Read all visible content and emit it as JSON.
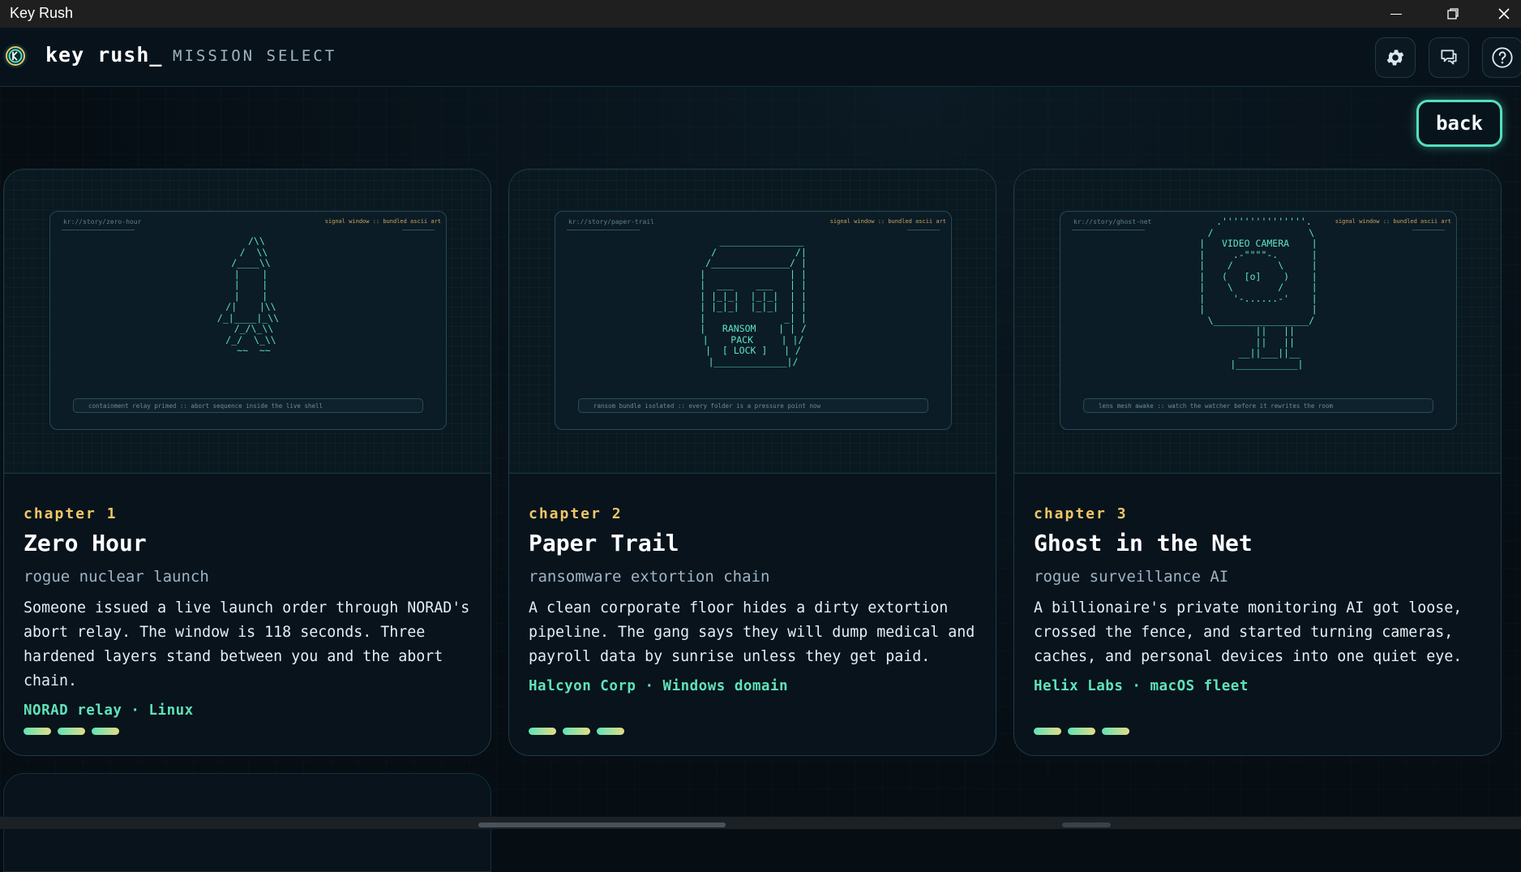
{
  "window": {
    "title": "Key Rush",
    "minimize_glyph": "—",
    "close_glyph": "✕"
  },
  "header": {
    "logo_glyph": "K",
    "brand": "key rush_",
    "subtitle": "MISSION SELECT",
    "icons": [
      "gear-icon",
      "chat-icon",
      "help-icon"
    ]
  },
  "back_label": "back",
  "cards": [
    {
      "url": "kr://story/zero-hour",
      "signal": "signal window :: bundled ascii art",
      "ascii": "   /\\\\\n  /  \\\\\n /____\\\\\n |    |\n |    |\n |    |\n /|    |\\\\\n/_|____|_\\\\\n  /_/\\_\\\\\n /_/  \\_\\\\\n  ~~  ~~",
      "status": "containment relay primed :: abort sequence inside the live shell",
      "chapter": "chapter 1",
      "title": "Zero Hour",
      "subtitle": "rogue nuclear launch",
      "description": "Someone issued a live launch order through NORAD's abort relay. The window is 118 seconds. Three hardened layers stand between you and the abort chain.",
      "meta": "NORAD relay · Linux"
    },
    {
      "url": "kr://story/paper-trail",
      "signal": "signal window :: bundled ascii art",
      "ascii": "   _______________\n  /              /|\n /______________/ |\n|               | |\n|  ___    ___   | |\n| |_|_|  |_|_|  | |\n| |_|_|  |_|_|  | |\n|              _| |\n|   RANSOM    | | /\n|    PACK     | |/\n|  [ LOCK ]   | /\n|_____________|/",
      "status": "ransom bundle isolated :: every folder is a pressure point now",
      "chapter": "chapter 2",
      "title": "Paper Trail",
      "subtitle": "ransomware extortion chain",
      "description": "A clean corporate floor hides a dirty extortion pipeline. The gang says they will dump medical and payroll data by sunrise unless they get paid.",
      "meta": "Halcyon Corp · Windows domain"
    },
    {
      "url": "kr://story/ghost-net",
      "signal": "signal window :: bundled ascii art",
      "ascii": "  .'''''''''''''''.\n /                 \\\n|   VIDEO CAMERA    |\n|     .-\"\"\"\"-.      |\n|    /        \\     |\n|   (   [o]    )    |\n|    \\        /     |\n|     '-......-'    |\n|                   |\n \\_________________/\n      ||   ||\n      ||   ||\n    __||___||__\n   |___________|",
      "status": "lens mesh awake :: watch the watcher before it rewrites the room",
      "chapter": "chapter 3",
      "title": "Ghost in the Net",
      "subtitle": "rogue surveillance AI",
      "description": "A billionaire's private monitoring AI got loose, crossed the fence, and started turning cameras, caches, and personal devices into one quiet eye.",
      "meta": "Helix Labs · macOS fleet"
    }
  ],
  "colors": {
    "accent": "#53e0c0",
    "chapter": "#f0c766",
    "meta": "#5fe3b8",
    "background": "#060d13"
  }
}
